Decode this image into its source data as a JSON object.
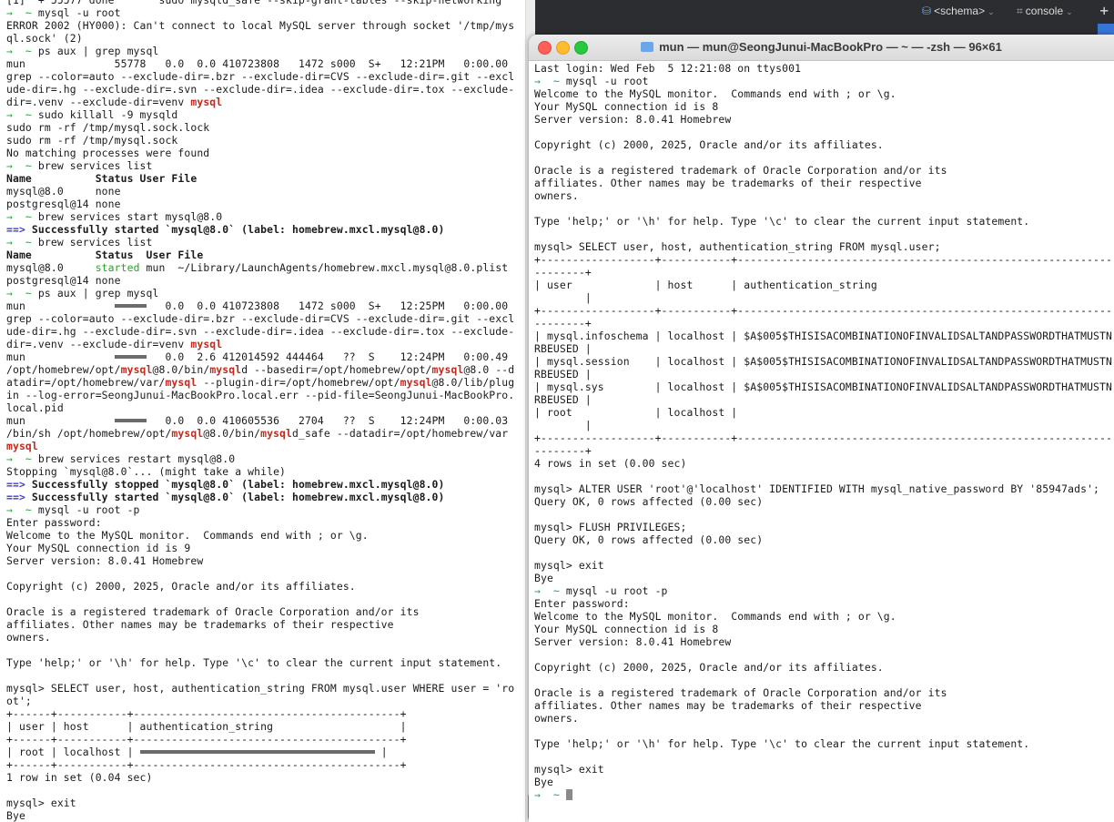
{
  "ide": {
    "schema_label": "<schema>",
    "console_label": "console",
    "schema_icon": "schema-icon",
    "console_icon": "console-icon"
  },
  "right_window": {
    "title": "mun — mun@SeongJunui-MacBookPro — ~ — -zsh — 96×61"
  },
  "left_terminal": [
    [
      [
        "",
        "[1]  + 55577 done       sudo mysqld_safe --skip-grant-tables --skip-networking"
      ]
    ],
    [
      [
        "prompt",
        "→  ~ "
      ],
      [
        "",
        "mysql -u root"
      ]
    ],
    [
      [
        "",
        "ERROR 2002 (HY000): Can't connect to local MySQL server through socket '/tmp/mys"
      ]
    ],
    [
      [
        "",
        "ql.sock' (2)"
      ]
    ],
    [
      [
        "prompt",
        "→  ~ "
      ],
      [
        "",
        "ps aux | grep mysql"
      ]
    ],
    [
      [
        "",
        "mun              55778   0.0  0.0 410723808   1472 s000  S+   12:21PM   0:00.00 "
      ]
    ],
    [
      [
        "",
        "grep --color=auto --exclude-dir=.bzr --exclude-dir=CVS --exclude-dir=.git --excl"
      ]
    ],
    [
      [
        "",
        "ude-dir=.hg --exclude-dir=.svn --exclude-dir=.idea --exclude-dir=.tox --exclude-"
      ]
    ],
    [
      [
        "",
        "dir=.venv --exclude-dir=venv "
      ],
      [
        "red",
        "mysql"
      ]
    ],
    [
      [
        "prompt",
        "→  ~ "
      ],
      [
        "",
        "sudo killall -9 mysqld"
      ]
    ],
    [
      [
        "",
        "sudo rm -rf /tmp/mysql.sock.lock"
      ]
    ],
    [
      [
        "",
        "sudo rm -rf /tmp/mysql.sock"
      ]
    ],
    [
      [
        "",
        "No matching processes were found"
      ]
    ],
    [
      [
        "prompt",
        "→  ~ "
      ],
      [
        "",
        "brew services list"
      ]
    ],
    [
      [
        "bold",
        "Name          Status User File"
      ]
    ],
    [
      [
        "",
        "mysql@8.0     none"
      ]
    ],
    [
      [
        "",
        "postgresql@14 none"
      ]
    ],
    [
      [
        "prompt",
        "→  ~ "
      ],
      [
        "",
        "brew services start mysql@8.0"
      ]
    ],
    [
      [
        "arrow",
        "==> "
      ],
      [
        "bold",
        "Successfully started `mysql@8.0` (label: homebrew.mxcl.mysql@8.0)"
      ]
    ],
    [
      [
        "prompt",
        "→  ~ "
      ],
      [
        "",
        "brew services list"
      ]
    ],
    [
      [
        "bold",
        "Name          Status  User File"
      ]
    ],
    [
      [
        "",
        "mysql@8.0     "
      ],
      [
        "green",
        "started"
      ],
      [
        "",
        " mun  ~/Library/LaunchAgents/homebrew.mxcl.mysql@8.0.plist"
      ]
    ],
    [
      [
        "",
        "postgresql@14 none"
      ]
    ],
    [
      [
        "prompt",
        "→  ~ "
      ],
      [
        "",
        "ps aux | grep mysql"
      ]
    ],
    [
      [
        "",
        "mun              "
      ],
      [
        "redact",
        "54553"
      ],
      [
        "",
        "   0.0  0.0 410723808   1472 s000  S+   12:25PM   0:00.00 "
      ]
    ],
    [
      [
        "",
        "grep --color=auto --exclude-dir=.bzr --exclude-dir=CVS --exclude-dir=.git --excl"
      ]
    ],
    [
      [
        "",
        "ude-dir=.hg --exclude-dir=.svn --exclude-dir=.idea --exclude-dir=.tox --exclude-"
      ]
    ],
    [
      [
        "",
        "dir=.venv --exclude-dir=venv "
      ],
      [
        "red",
        "mysql"
      ]
    ],
    [
      [
        "",
        "mun              "
      ],
      [
        "redact",
        "54000"
      ],
      [
        "",
        "   0.0  2.6 412014592 444464   ??  S    12:24PM   0:00.49 "
      ]
    ],
    [
      [
        "",
        "/opt/homebrew/opt/"
      ],
      [
        "red",
        "mysql"
      ],
      [
        "",
        "@8.0/bin/"
      ],
      [
        "red",
        "mysql"
      ],
      [
        "",
        "d --basedir=/opt/homebrew/opt/"
      ],
      [
        "red",
        "mysql"
      ],
      [
        "",
        "@8.0 --d"
      ]
    ],
    [
      [
        "",
        "atadir=/opt/homebrew/var/"
      ],
      [
        "red",
        "mysql"
      ],
      [
        "",
        " --plugin-dir=/opt/homebrew/opt/"
      ],
      [
        "red",
        "mysql"
      ],
      [
        "",
        "@8.0/lib/plug"
      ]
    ],
    [
      [
        "",
        "in --log-error=SeongJunui-MacBookPro.local.err --pid-file=SeongJunui-MacBookPro."
      ]
    ],
    [
      [
        "",
        "local.pid"
      ]
    ],
    [
      [
        "",
        "mun              "
      ],
      [
        "redact",
        "54264"
      ],
      [
        "",
        "   0.0  0.0 410605536   2704   ??  S    12:24PM   0:00.03 "
      ]
    ],
    [
      [
        "",
        "/bin/sh /opt/homebrew/opt/"
      ],
      [
        "red",
        "mysql"
      ],
      [
        "",
        "@8.0/bin/"
      ],
      [
        "red",
        "mysql"
      ],
      [
        "",
        "d_safe --datadir=/opt/homebrew/var"
      ]
    ],
    [
      [
        "red",
        "mysql"
      ]
    ],
    [
      [
        "prompt",
        "→  ~ "
      ],
      [
        "",
        "brew services restart mysql@8.0"
      ]
    ],
    [
      [
        "",
        "Stopping `mysql@8.0`... (might take a while)"
      ]
    ],
    [
      [
        "arrow",
        "==> "
      ],
      [
        "bold",
        "Successfully stopped `mysql@8.0` (label: homebrew.mxcl.mysql@8.0)"
      ]
    ],
    [
      [
        "arrow",
        "==> "
      ],
      [
        "bold",
        "Successfully started `mysql@8.0` (label: homebrew.mxcl.mysql@8.0)"
      ]
    ],
    [
      [
        "prompt",
        "→  ~ "
      ],
      [
        "",
        "mysql -u root -p"
      ]
    ],
    [
      [
        "",
        "Enter password:"
      ]
    ],
    [
      [
        "",
        "Welcome to the MySQL monitor.  Commands end with ; or \\g."
      ]
    ],
    [
      [
        "",
        "Your MySQL connection id is 9"
      ]
    ],
    [
      [
        "",
        "Server version: 8.0.41 Homebrew"
      ]
    ],
    [
      [
        "",
        ""
      ]
    ],
    [
      [
        "",
        "Copyright (c) 2000, 2025, Oracle and/or its affiliates."
      ]
    ],
    [
      [
        "",
        ""
      ]
    ],
    [
      [
        "",
        "Oracle is a registered trademark of Oracle Corporation and/or its"
      ]
    ],
    [
      [
        "",
        "affiliates. Other names may be trademarks of their respective"
      ]
    ],
    [
      [
        "",
        "owners."
      ]
    ],
    [
      [
        "",
        ""
      ]
    ],
    [
      [
        "",
        "Type 'help;' or '\\h' for help. Type '\\c' to clear the current input statement."
      ]
    ],
    [
      [
        "",
        ""
      ]
    ],
    [
      [
        "",
        "mysql> SELECT user, host, authentication_string FROM mysql.user WHERE user = 'ro"
      ]
    ],
    [
      [
        "",
        "ot';"
      ]
    ],
    [
      [
        "",
        "+------+-----------+------------------------------------------+"
      ]
    ],
    [
      [
        "",
        "| user | host      | authentication_string                    |"
      ]
    ],
    [
      [
        "",
        "+------+-----------+------------------------------------------+"
      ]
    ],
    [
      [
        "",
        "| root | localhost | "
      ],
      [
        "redact",
        "*A7C8C5AB1E5F7F1CD7A2F1E5CBDF5DE13E49"
      ],
      [
        "",
        " |"
      ]
    ],
    [
      [
        "",
        "+------+-----------+------------------------------------------+"
      ]
    ],
    [
      [
        "",
        "1 row in set (0.04 sec)"
      ]
    ],
    [
      [
        "",
        ""
      ]
    ],
    [
      [
        "",
        "mysql> exit"
      ]
    ],
    [
      [
        "",
        "Bye"
      ]
    ]
  ],
  "right_terminal": [
    [
      [
        "",
        "Last login: Wed Feb  5 12:21:08 on ttys001"
      ]
    ],
    [
      [
        "prompt",
        "→  ~ "
      ],
      [
        "",
        "mysql -u root"
      ]
    ],
    [
      [
        "",
        "Welcome to the MySQL monitor.  Commands end with ; or \\g."
      ]
    ],
    [
      [
        "",
        "Your MySQL connection id is 8"
      ]
    ],
    [
      [
        "",
        "Server version: 8.0.41 Homebrew"
      ]
    ],
    [
      [
        "",
        ""
      ]
    ],
    [
      [
        "",
        "Copyright (c) 2000, 2025, Oracle and/or its affiliates."
      ]
    ],
    [
      [
        "",
        ""
      ]
    ],
    [
      [
        "",
        "Oracle is a registered trademark of Oracle Corporation and/or its"
      ]
    ],
    [
      [
        "",
        "affiliates. Other names may be trademarks of their respective"
      ]
    ],
    [
      [
        "",
        "owners."
      ]
    ],
    [
      [
        "",
        ""
      ]
    ],
    [
      [
        "",
        "Type 'help;' or '\\h' for help. Type '\\c' to clear the current input statement."
      ]
    ],
    [
      [
        "",
        ""
      ]
    ],
    [
      [
        "",
        "mysql> SELECT user, host, authentication_string FROM mysql.user;"
      ]
    ],
    [
      [
        "",
        "+------------------+-----------+------------------------------------------------------------------"
      ]
    ],
    [
      [
        "",
        "--------+"
      ]
    ],
    [
      [
        "",
        "| user             | host      | authentication_string"
      ]
    ],
    [
      [
        "",
        "        |"
      ]
    ],
    [
      [
        "",
        "+------------------+-----------+------------------------------------------------------------------"
      ]
    ],
    [
      [
        "",
        "--------+"
      ]
    ],
    [
      [
        "",
        "| mysql.infoschema | localhost | $A$005$THISISACOMBINATIONOFINVALIDSALTANDPASSWORDTHATMUSTN"
      ]
    ],
    [
      [
        "",
        "RBEUSED |"
      ]
    ],
    [
      [
        "",
        "| mysql.session    | localhost | $A$005$THISISACOMBINATIONOFINVALIDSALTANDPASSWORDTHATMUSTN"
      ]
    ],
    [
      [
        "",
        "RBEUSED |"
      ]
    ],
    [
      [
        "",
        "| mysql.sys        | localhost | $A$005$THISISACOMBINATIONOFINVALIDSALTANDPASSWORDTHATMUSTN"
      ]
    ],
    [
      [
        "",
        "RBEUSED |"
      ]
    ],
    [
      [
        "",
        "| root             | localhost |"
      ]
    ],
    [
      [
        "",
        "        |"
      ]
    ],
    [
      [
        "",
        "+------------------+-----------+------------------------------------------------------------------"
      ]
    ],
    [
      [
        "",
        "--------+"
      ]
    ],
    [
      [
        "",
        "4 rows in set (0.00 sec)"
      ]
    ],
    [
      [
        "",
        ""
      ]
    ],
    [
      [
        "",
        "mysql> ALTER USER 'root'@'localhost' IDENTIFIED WITH mysql_native_password BY '85947ads';"
      ]
    ],
    [
      [
        "",
        "Query OK, 0 rows affected (0.00 sec)"
      ]
    ],
    [
      [
        "",
        ""
      ]
    ],
    [
      [
        "",
        "mysql> FLUSH PRIVILEGES;"
      ]
    ],
    [
      [
        "",
        "Query OK, 0 rows affected (0.00 sec)"
      ]
    ],
    [
      [
        "",
        ""
      ]
    ],
    [
      [
        "",
        "mysql> exit"
      ]
    ],
    [
      [
        "",
        "Bye"
      ]
    ],
    [
      [
        "prompt",
        "→  ~ "
      ],
      [
        "",
        "mysql -u root -p"
      ]
    ],
    [
      [
        "",
        "Enter password:"
      ]
    ],
    [
      [
        "",
        "Welcome to the MySQL monitor.  Commands end with ; or \\g."
      ]
    ],
    [
      [
        "",
        "Your MySQL connection id is 8"
      ]
    ],
    [
      [
        "",
        "Server version: 8.0.41 Homebrew"
      ]
    ],
    [
      [
        "",
        ""
      ]
    ],
    [
      [
        "",
        "Copyright (c) 2000, 2025, Oracle and/or its affiliates."
      ]
    ],
    [
      [
        "",
        ""
      ]
    ],
    [
      [
        "",
        "Oracle is a registered trademark of Oracle Corporation and/or its"
      ]
    ],
    [
      [
        "",
        "affiliates. Other names may be trademarks of their respective"
      ]
    ],
    [
      [
        "",
        "owners."
      ]
    ],
    [
      [
        "",
        ""
      ]
    ],
    [
      [
        "",
        "Type 'help;' or '\\h' for help. Type '\\c' to clear the current input statement."
      ]
    ],
    [
      [
        "",
        ""
      ]
    ],
    [
      [
        "",
        "mysql> exit"
      ]
    ],
    [
      [
        "",
        "Bye"
      ]
    ],
    [
      [
        "prompt",
        "→  ~ "
      ]
    ]
  ]
}
